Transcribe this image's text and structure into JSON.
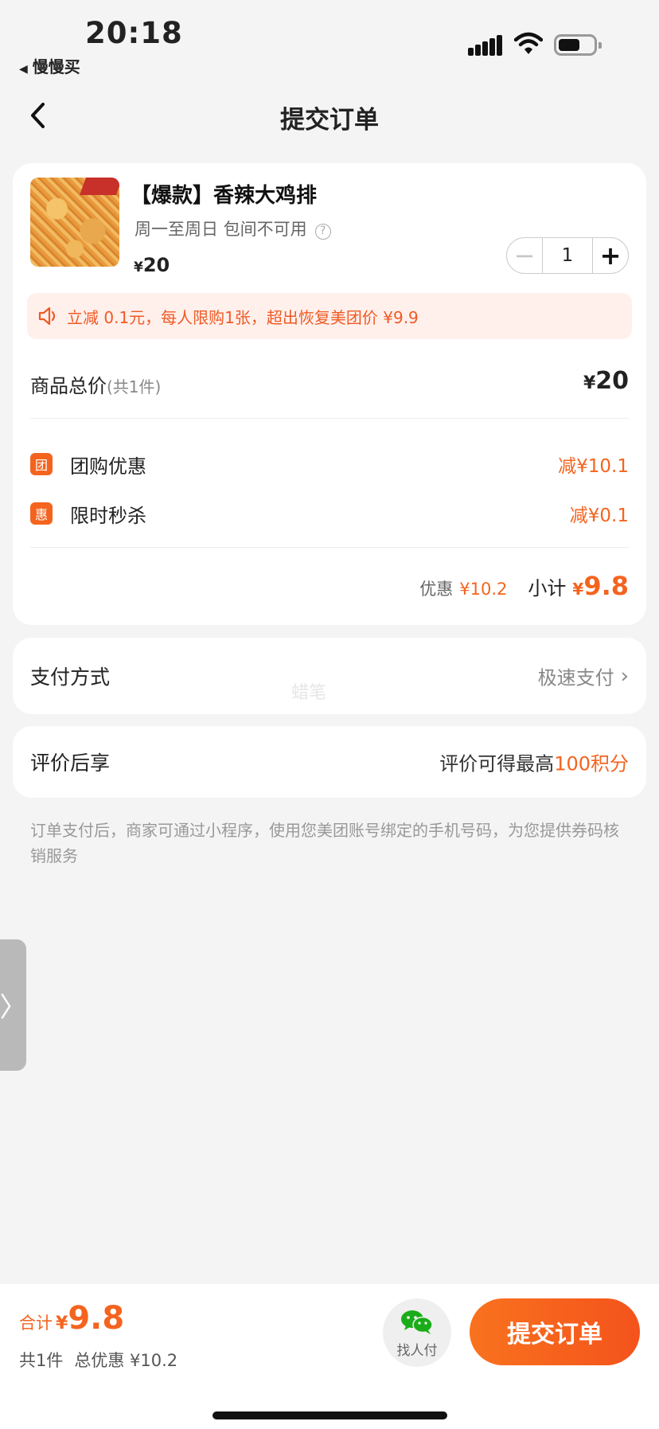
{
  "status_bar": {
    "time": "20:18",
    "back_app": "慢慢买"
  },
  "nav": {
    "title": "提交订单"
  },
  "product": {
    "title": "【爆款】香辣大鸡排",
    "availability": "周一至周日 包间不可用",
    "price_symbol": "¥",
    "price": "20",
    "quantity": "1"
  },
  "promo_banner": "立减 0.1元，每人限购1张，超出恢复美团价 ¥9.9",
  "summary": {
    "total_label": "商品总价",
    "total_count": "(共1件)",
    "total_symbol": "¥",
    "total_value": "20",
    "discounts": [
      {
        "badge": "团",
        "label": "团购优惠",
        "value": "减¥10.1"
      },
      {
        "badge": "惠",
        "label": "限时秒杀",
        "value": "减¥0.1"
      }
    ],
    "saved_label": "优惠",
    "saved_value": "¥10.2",
    "subtotal_label": "小计",
    "subtotal_symbol": "¥",
    "subtotal_value": "9.8"
  },
  "payment": {
    "label": "支付方式",
    "value": "极速支付"
  },
  "watermark": "蜡笔",
  "review": {
    "label": "评价后享",
    "text": "评价可得最高",
    "points": "100积分"
  },
  "notice": "订单支付后，商家可通过小程序，使用您美团账号绑定的手机号码，为您提供券码核销服务",
  "bottom_bar": {
    "total_label": "合计",
    "total_symbol": "¥",
    "total_value": "9.8",
    "count": "共1件",
    "discount": "总优惠 ¥10.2",
    "find_pay_label": "找人付",
    "submit_label": "提交订单"
  },
  "colors": {
    "accent": "#f4641f",
    "background": "#f4f4f4",
    "banner_bg": "#fff0ec"
  },
  "icons": {
    "back": "chevron-left-icon",
    "help": "question-circle-icon",
    "speaker": "speaker-icon",
    "payment_chevron": "chevron-right-icon",
    "find_pay": "wechat-icon",
    "side_tab": "chevron-right-icon"
  }
}
